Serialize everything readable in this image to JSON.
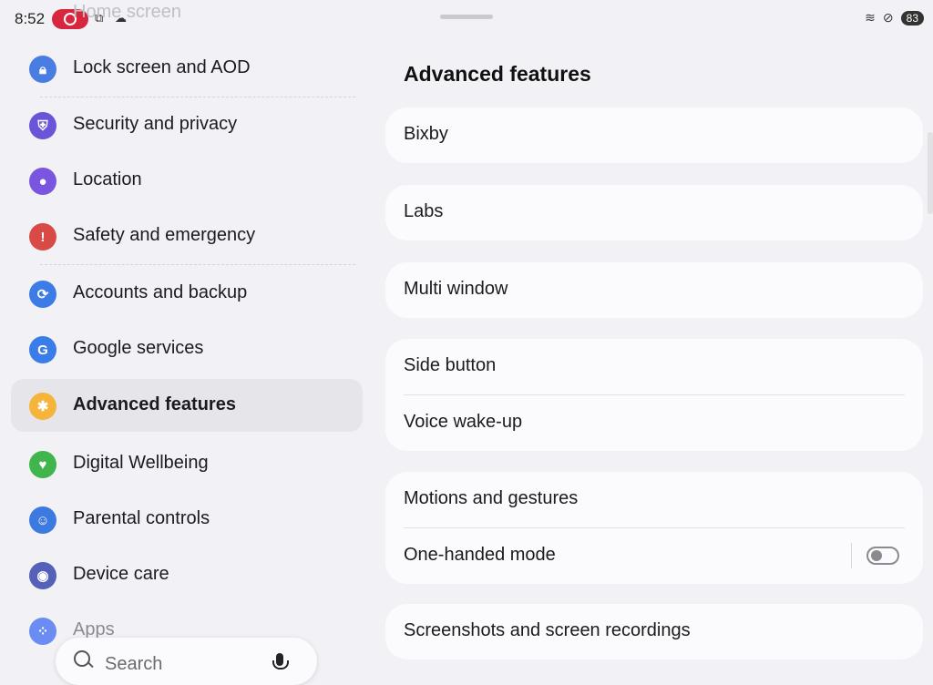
{
  "status_bar": {
    "time": "8:52",
    "battery": "83"
  },
  "left_pane": {
    "ghost_text": "Home screen",
    "items": [
      {
        "label": "Lock screen and AOD",
        "icon": "lock-icon",
        "color": "#4a7de2",
        "active": false
      },
      {
        "label": "Security and privacy",
        "icon": "shield-icon",
        "color": "#6a55d8",
        "active": false
      },
      {
        "label": "Location",
        "icon": "location-pin-icon",
        "color": "#7a55e0",
        "active": false
      },
      {
        "label": "Safety and emergency",
        "icon": "alert-icon",
        "color": "#d94a46",
        "active": false
      },
      {
        "label": "Accounts and backup",
        "icon": "sync-icon",
        "color": "#3d7be6",
        "active": false
      },
      {
        "label": "Google services",
        "icon": "google-icon",
        "color": "#3a7ce8",
        "active": false
      },
      {
        "label": "Advanced features",
        "icon": "gear-icon",
        "color": "#f4b53a",
        "active": true
      },
      {
        "label": "Digital Wellbeing",
        "icon": "heart-icon",
        "color": "#3fb54b",
        "active": false
      },
      {
        "label": "Parental controls",
        "icon": "family-icon",
        "color": "#3c7ae0",
        "active": false
      },
      {
        "label": "Device care",
        "icon": "device-care-icon",
        "color": "#5561b8",
        "active": false
      },
      {
        "label": "Apps",
        "icon": "apps-grid-icon",
        "color": "#6b8cf2",
        "active": false
      }
    ],
    "search": {
      "placeholder": "Search"
    }
  },
  "right_pane": {
    "title": "Advanced features",
    "cards": [
      {
        "rows": [
          {
            "label": "Bixby"
          }
        ]
      },
      {
        "rows": [
          {
            "label": "Labs"
          }
        ]
      },
      {
        "rows": [
          {
            "label": "Multi window"
          }
        ]
      },
      {
        "rows": [
          {
            "label": "Side button"
          },
          {
            "label": "Voice wake-up"
          }
        ]
      },
      {
        "rows": [
          {
            "label": "Motions and gestures"
          },
          {
            "label": "One-handed mode",
            "toggle": false
          }
        ]
      },
      {
        "rows": [
          {
            "label": "Screenshots and screen recordings"
          }
        ]
      }
    ]
  }
}
